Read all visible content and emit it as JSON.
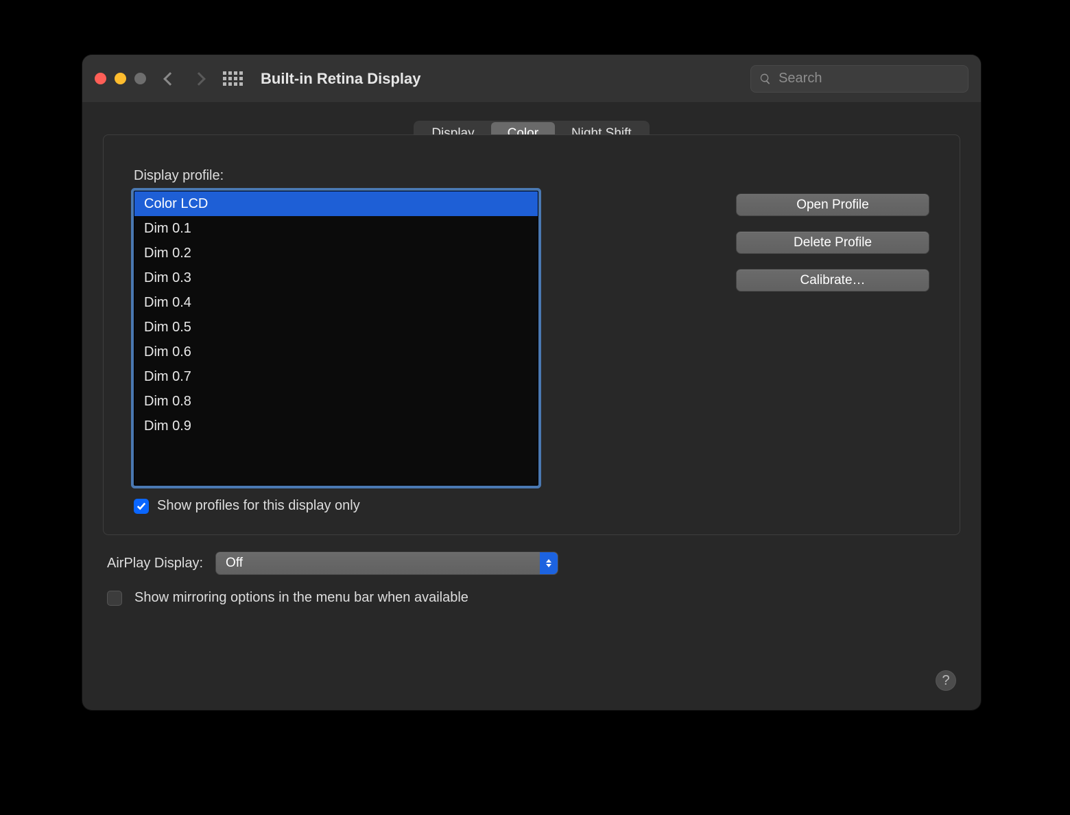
{
  "window": {
    "title": "Built-in Retina Display"
  },
  "search": {
    "placeholder": "Search"
  },
  "tabs": [
    {
      "label": "Display",
      "active": false
    },
    {
      "label": "Color",
      "active": true
    },
    {
      "label": "Night Shift",
      "active": false
    }
  ],
  "profile": {
    "label": "Display profile:",
    "items": [
      "Color LCD",
      "Dim 0.1",
      "Dim 0.2",
      "Dim 0.3",
      "Dim 0.4",
      "Dim 0.5",
      "Dim 0.6",
      "Dim 0.7",
      "Dim 0.8",
      "Dim 0.9"
    ],
    "selected_index": 0
  },
  "buttons": {
    "open": "Open Profile",
    "delete": "Delete Profile",
    "calibrate": "Calibrate…"
  },
  "show_profiles_checkbox": {
    "label": "Show profiles for this display only",
    "checked": true
  },
  "airplay": {
    "label": "AirPlay Display:",
    "value": "Off"
  },
  "mirroring_checkbox": {
    "label": "Show mirroring options in the menu bar when available",
    "checked": false
  },
  "help_glyph": "?"
}
